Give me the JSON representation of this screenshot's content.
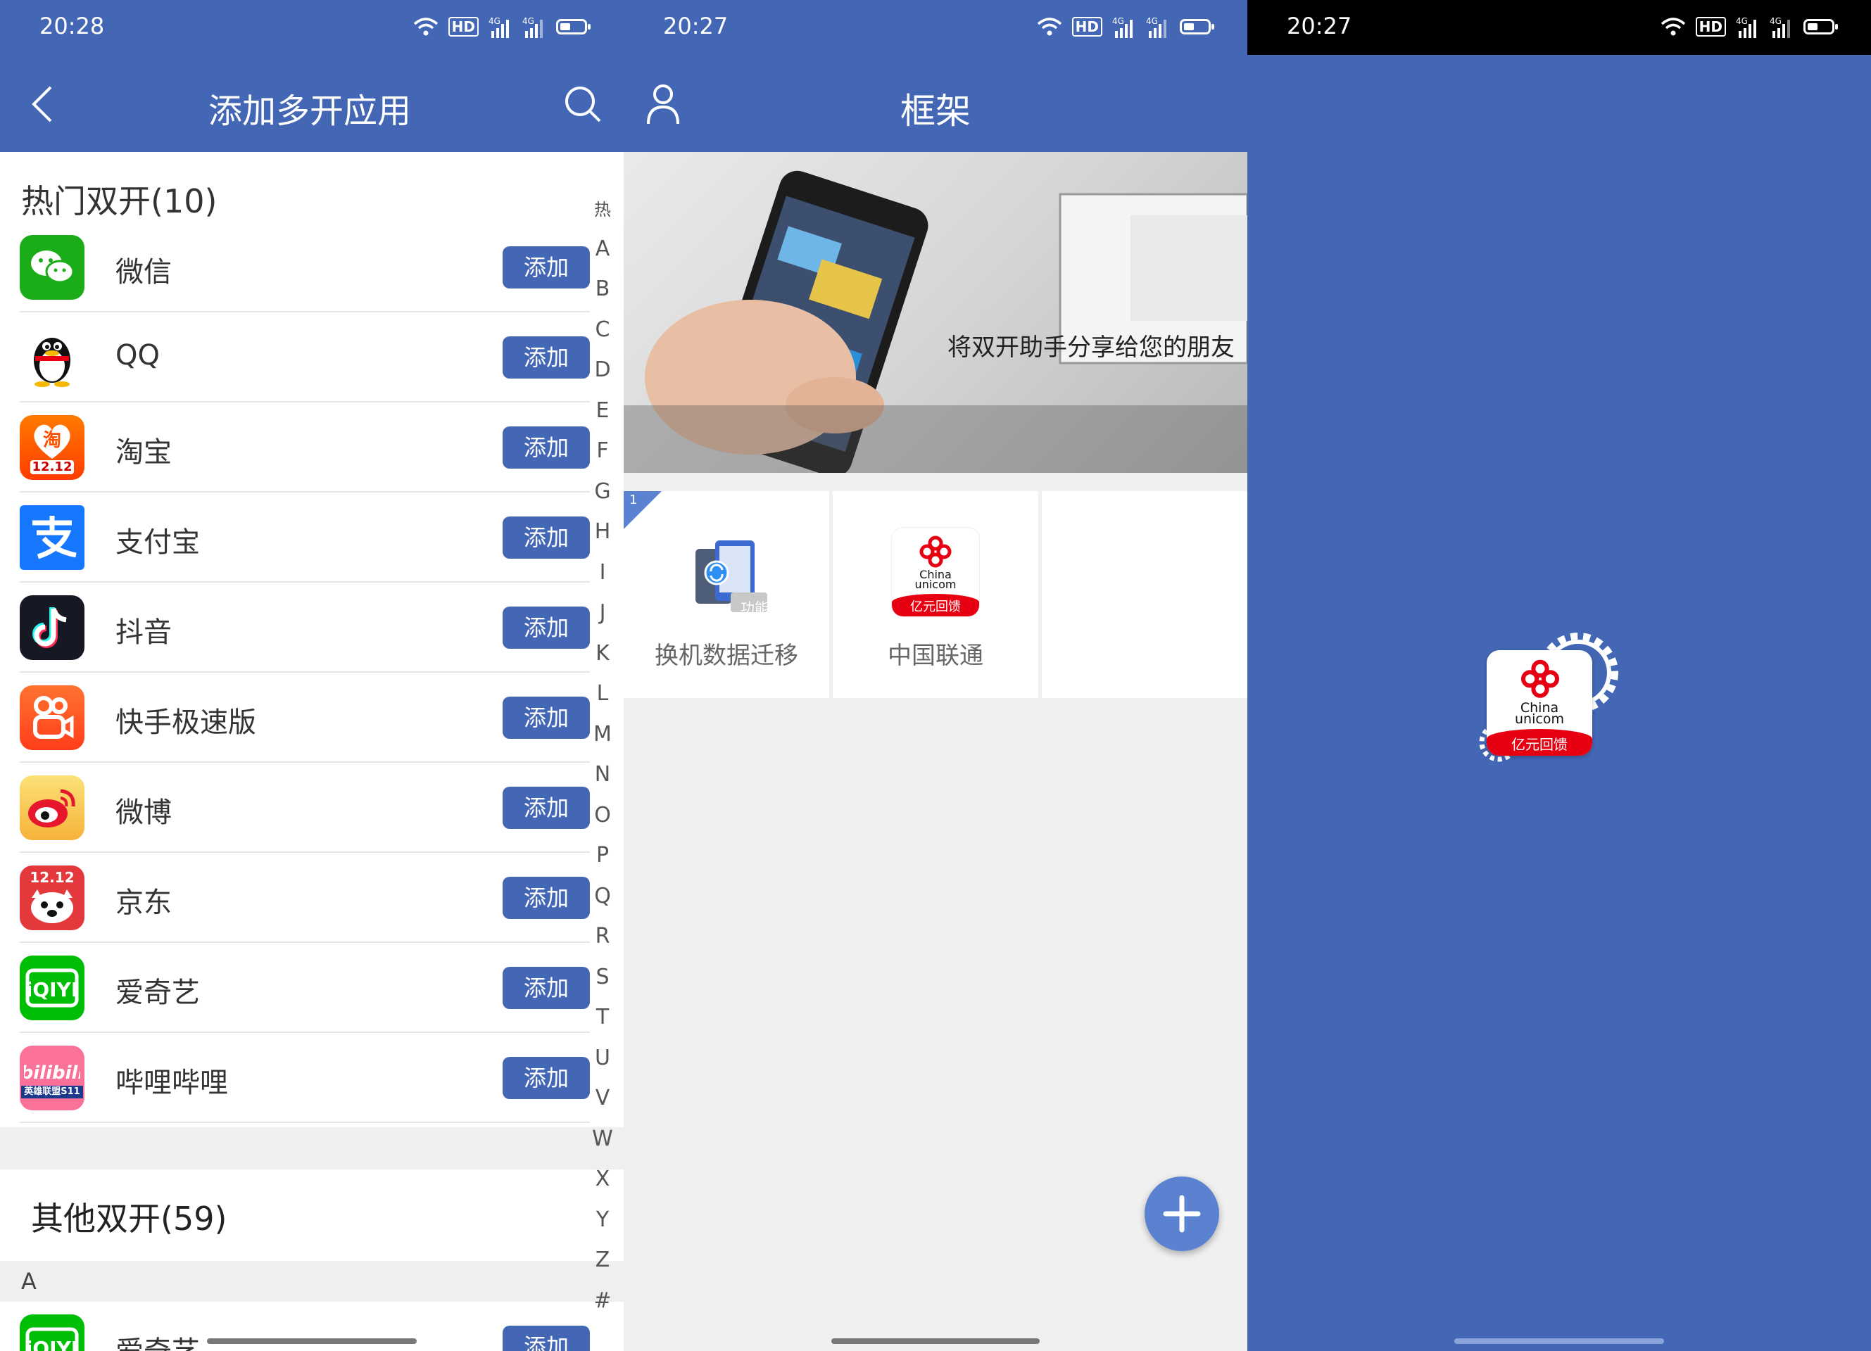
{
  "panel1": {
    "status": {
      "time": "20:28",
      "hd": "HD",
      "net1": "4G",
      "net2": "4G"
    },
    "title": "添加多开应用",
    "hot_section": "热门双开(10)",
    "add_label": "添加",
    "apps": [
      {
        "name": "微信",
        "icon": "wechat-icon",
        "color": "#1aad19"
      },
      {
        "name": "QQ",
        "icon": "qq-icon",
        "color": "#ffffff"
      },
      {
        "name": "淘宝",
        "icon": "taobao-icon",
        "color": "#ff5000"
      },
      {
        "name": "支付宝",
        "icon": "alipay-icon",
        "color": "#1677ff"
      },
      {
        "name": "抖音",
        "icon": "douyin-icon",
        "color": "#161823"
      },
      {
        "name": "快手极速版",
        "icon": "kuaishou-icon",
        "color": "#ff4906"
      },
      {
        "name": "微博",
        "icon": "weibo-icon",
        "color": "#f6c343"
      },
      {
        "name": "京东",
        "icon": "jd-icon",
        "color": "#e4393c"
      },
      {
        "name": "爱奇艺",
        "icon": "iqiyi-icon",
        "color": "#00be06"
      },
      {
        "name": "哔哩哔哩",
        "icon": "bilibili-icon",
        "color": "#fb7299"
      }
    ],
    "taobao_badge": "12.12",
    "jd_badge": "12.12",
    "bili_badge": "英雄联盟S11",
    "other_section": "其他双开(59)",
    "letter_header": "A",
    "partial_app": "爱奇艺",
    "index": [
      "热",
      "A",
      "B",
      "C",
      "D",
      "E",
      "F",
      "G",
      "H",
      "I",
      "J",
      "K",
      "L",
      "M",
      "N",
      "O",
      "P",
      "Q",
      "R",
      "S",
      "T",
      "U",
      "V",
      "W",
      "X",
      "Y",
      "Z",
      "#"
    ]
  },
  "panel2": {
    "status": {
      "time": "20:27",
      "hd": "HD",
      "net1": "4G",
      "net2": "4G"
    },
    "title": "框架",
    "banner_caption": "将双开助手分享给您的朋友",
    "corner_badge": "1",
    "tiles": [
      {
        "name": "换机数据迁移",
        "tag": "功能",
        "icon": "data-migration-icon"
      },
      {
        "name": "中国联通",
        "icon": "china-unicom-icon",
        "sub1": "China",
        "sub2": "unicom",
        "sub3": "亿元回馈"
      }
    ]
  },
  "panel3": {
    "status": {
      "time": "20:27",
      "hd": "HD",
      "net1": "4G",
      "net2": "4G"
    },
    "splash": {
      "sub1": "China",
      "sub2": "unicom",
      "sub3": "亿元回馈",
      "icon": "china-unicom-icon"
    }
  }
}
